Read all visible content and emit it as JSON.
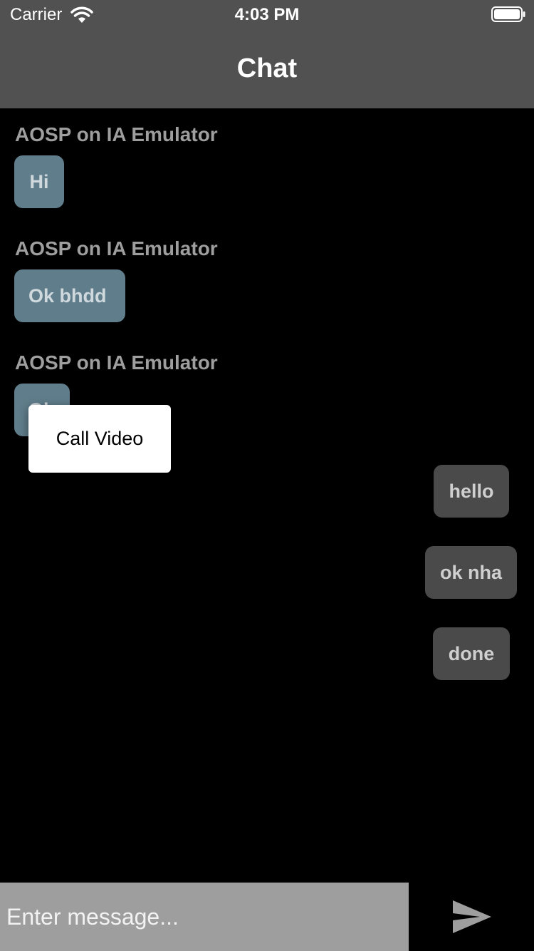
{
  "status_bar": {
    "carrier": "Carrier",
    "time": "4:03 PM"
  },
  "nav": {
    "title": "Chat"
  },
  "messages_in": [
    {
      "sender": "AOSP on IA Emulator",
      "text": "Hi"
    },
    {
      "sender": "AOSP on IA Emulator",
      "text": "Ok bhdd"
    },
    {
      "sender": "AOSP on IA Emulator",
      "text": "Ok"
    }
  ],
  "messages_out": [
    {
      "text": "hello"
    },
    {
      "text": "ok nha"
    },
    {
      "text": "done"
    }
  ],
  "popup": {
    "label": "Call Video"
  },
  "composer": {
    "placeholder": "Enter message...",
    "value": ""
  },
  "icons": {
    "wifi": "wifi-icon",
    "battery": "battery-icon",
    "send": "send-icon"
  },
  "colors": {
    "bar": "#515151",
    "background": "#000000",
    "incoming_bubble": "#607d8b",
    "outgoing_bubble": "#4a4a4a",
    "composer": "#9e9e9e"
  }
}
